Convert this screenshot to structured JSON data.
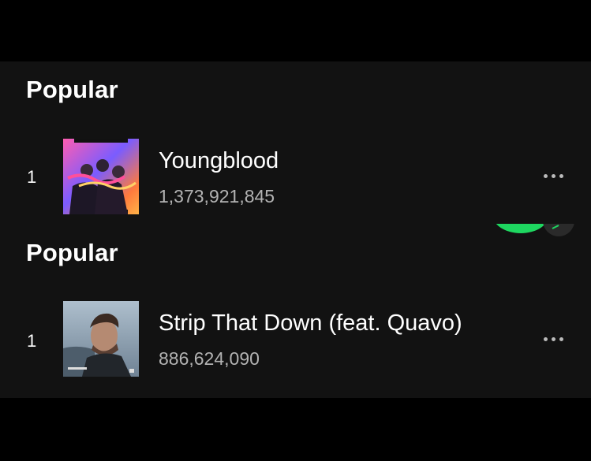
{
  "sections": [
    {
      "title": "Popular",
      "track": {
        "number": "1",
        "title": "Youngblood",
        "plays": "1,373,921,845",
        "art_icon": "album-art-youngblood"
      }
    },
    {
      "title": "Popular",
      "track": {
        "number": "1",
        "title": "Strip That Down (feat. Quavo)",
        "plays": "886,624,090",
        "art_icon": "album-art-strip-that-down"
      }
    }
  ],
  "colors": {
    "background": "#121212",
    "text_primary": "#ffffff",
    "text_secondary": "#b3b3b3",
    "accent_green": "#1ed760"
  },
  "icons": {
    "more": "more-options-icon",
    "play": "play-button-icon"
  }
}
